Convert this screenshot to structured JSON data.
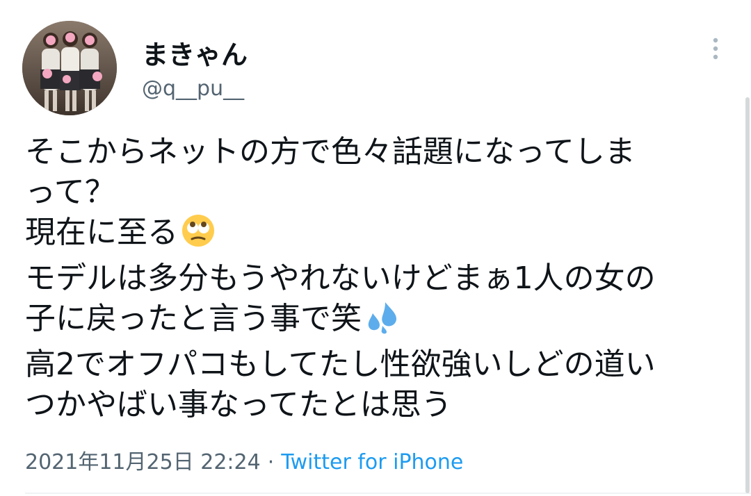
{
  "user": {
    "display_name": "まきゃん",
    "handle": "@q__pu__"
  },
  "tweet": {
    "lines": [
      "そこからネットの方で色々話題になってしま",
      "って？",
      "現在に至る",
      "モデルは多分もうやれないけどまぁ1人の女の",
      "子に戻ったと言う事で笑",
      "高2でオフパコもしてたし性欲強いしどの道い",
      "つかやばい事なってたとは思う"
    ],
    "emojis": [
      "rolling-eyes-emoji",
      "sweat-droplets-emoji"
    ]
  },
  "meta": {
    "timestamp": "2021年11月25日 22:24",
    "separator": "·",
    "source": "Twitter for iPhone"
  },
  "icons": {
    "more": "vertical-ellipsis-icon"
  },
  "colors": {
    "text_primary": "#0f1419",
    "text_secondary": "#536471",
    "link": "#1d9bf0"
  }
}
